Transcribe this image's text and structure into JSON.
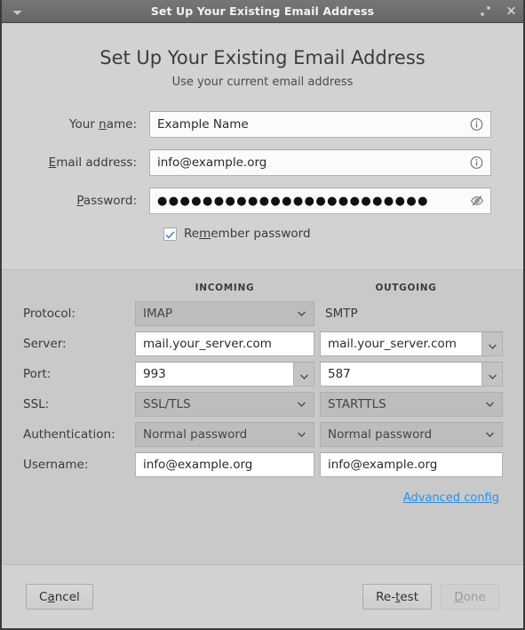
{
  "window": {
    "title": "Set Up Your Existing Email Address",
    "menu_icon": "chevron-down-icon",
    "maximize_icon": "maximize-icon",
    "close_icon": "close-icon"
  },
  "header": {
    "heading": "Set Up Your Existing Email Address",
    "subheading": "Use your current email address"
  },
  "account_form": {
    "rows": [
      {
        "label_pre": "Your ",
        "label_mn": "n",
        "label_post": "ame:",
        "value": "Example Name",
        "icon": "info-icon"
      },
      {
        "label_pre": "",
        "label_mn": "E",
        "label_post": "mail address:",
        "value": "info@example.org",
        "icon": "info-icon"
      },
      {
        "label_pre": "",
        "label_mn": "P",
        "label_post": "assword:",
        "value": "●●●●●●●●●●●●●●●●●●●●●●●●",
        "icon": "eye-slash-icon"
      }
    ],
    "remember": {
      "checked": true,
      "label_pre": "Re",
      "label_mn": "m",
      "label_post": "ember password"
    }
  },
  "settings": {
    "col_incoming": "INCOMING",
    "col_outgoing": "OUTGOING",
    "protocol": {
      "label": "Protocol:",
      "incoming": "IMAP",
      "outgoing": "SMTP"
    },
    "server": {
      "label": "Server:",
      "incoming": "mail.your_server.com",
      "outgoing": "mail.your_server.com"
    },
    "port": {
      "label": "Port:",
      "incoming": "993",
      "outgoing": "587"
    },
    "ssl": {
      "label": "SSL:",
      "incoming": "SSL/TLS",
      "outgoing": "STARTTLS"
    },
    "auth": {
      "label": "Authentication:",
      "incoming": "Normal password",
      "outgoing": "Normal password"
    },
    "username": {
      "label": "Username:",
      "incoming": "info@example.org",
      "outgoing": "info@example.org"
    },
    "advanced": {
      "mn": "A",
      "rest": "dvanced config"
    }
  },
  "footer": {
    "cancel": {
      "pre": "C",
      "mn": "a",
      "post": "ncel"
    },
    "retest": {
      "pre": "Re-",
      "mn": "t",
      "post": "est"
    },
    "done": {
      "pre": "",
      "mn": "D",
      "post": "one",
      "disabled": true
    }
  },
  "colors": {
    "link": "#2a8ff0",
    "check": "#3584e4",
    "titlebar": "#6e6e6e",
    "top_bg": "#d2d2d2",
    "settings_bg": "#c9c9c9"
  }
}
